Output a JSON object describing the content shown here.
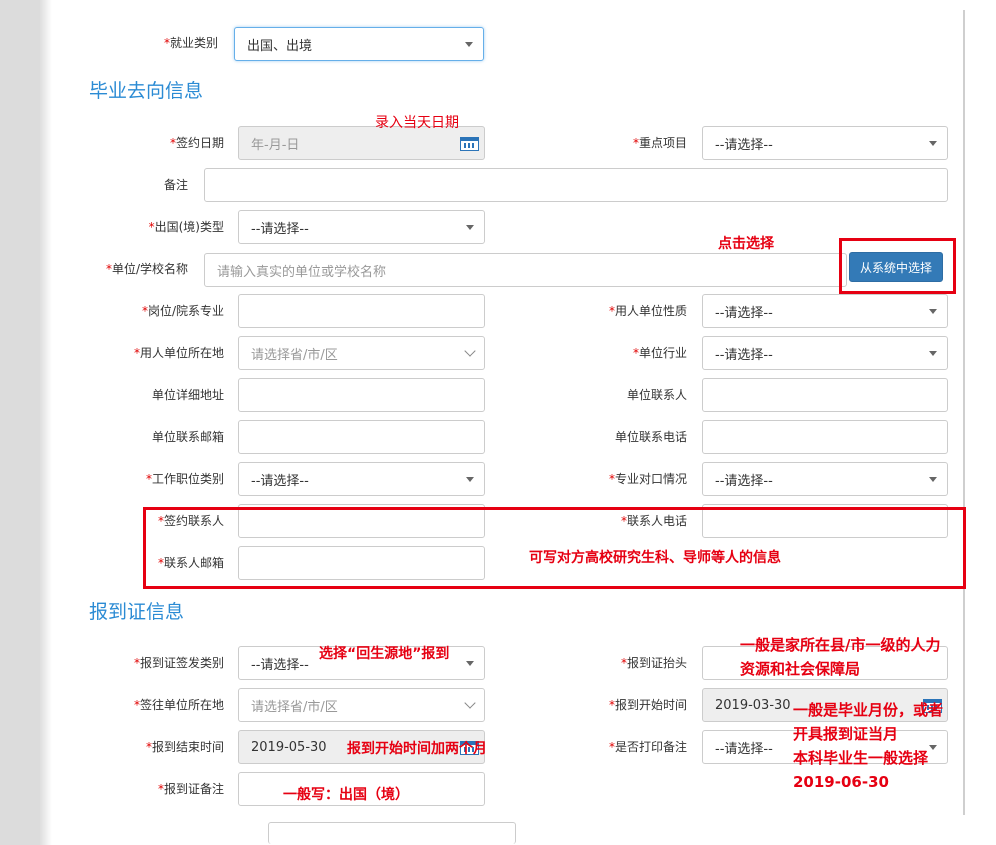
{
  "employment_type": {
    "label": "就业类别",
    "value": "出国、出境"
  },
  "section_destination": "毕业去向信息",
  "sign_date": {
    "label": "签约日期",
    "placeholder": "年-月-日"
  },
  "key_project": {
    "label": "重点项目",
    "value": "--请选择--"
  },
  "remark": {
    "label": "备注",
    "value": ""
  },
  "abroad_type": {
    "label": "出国(境)类型",
    "value": "--请选择--"
  },
  "org_name": {
    "label": "单位/学校名称",
    "placeholder": "请输入真实的单位或学校名称"
  },
  "select_from_system_button": "从系统中选择",
  "position_major": {
    "label": "岗位/院系专业",
    "value": ""
  },
  "employer_nature": {
    "label": "用人单位性质",
    "value": "--请选择--"
  },
  "employer_location": {
    "label": "用人单位所在地",
    "placeholder": "请选择省/市/区"
  },
  "industry": {
    "label": "单位行业",
    "value": "--请选择--"
  },
  "org_address": {
    "label": "单位详细地址",
    "value": ""
  },
  "org_contact": {
    "label": "单位联系人",
    "value": ""
  },
  "org_email": {
    "label": "单位联系邮箱",
    "value": ""
  },
  "org_phone": {
    "label": "单位联系电话",
    "value": ""
  },
  "job_category": {
    "label": "工作职位类别",
    "value": "--请选择--"
  },
  "major_match": {
    "label": "专业对口情况",
    "value": "--请选择--"
  },
  "sign_contact": {
    "label": "签约联系人",
    "value": ""
  },
  "contact_phone": {
    "label": "联系人电话",
    "value": ""
  },
  "contact_email": {
    "label": "联系人邮箱",
    "value": ""
  },
  "section_report": "报到证信息",
  "report_issue_type": {
    "label": "报到证签发类别",
    "value": "--请选择--"
  },
  "report_header": {
    "label": "报到证抬头",
    "value": ""
  },
  "destination_location": {
    "label": "签往单位所在地",
    "placeholder": "请选择省/市/区"
  },
  "report_start": {
    "label": "报到开始时间",
    "value": "2019-03-30"
  },
  "report_end": {
    "label": "报到结束时间",
    "value": "2019-05-30"
  },
  "print_remark": {
    "label": "是否打印备注",
    "value": "--请选择--"
  },
  "report_remark": {
    "label": "报到证备注",
    "value": ""
  },
  "annotations": {
    "today_date": "录入当天日期",
    "click_select": "点击选择",
    "contact_info": "可写对方高校研究生科、导师等人的信息",
    "choose_origin": "选择“回生源地”报到",
    "header_line1": "一般是家所在县/市一级的人力",
    "header_line2": "资源和社会保障局",
    "add_two_months": "报到开始时间加两个月",
    "start_line1": "一般是毕业月份，或者",
    "start_line2": "开具报到证当月",
    "start_line3": "本科毕业生一般选择",
    "start_line4": "2019-06-30",
    "remark_hint": "一般写：出国（境）"
  },
  "colors": {
    "accent": "#2b8bd4",
    "annotation_red": "#e60012",
    "button_blue": "#337ab7",
    "required_red": "#e00000"
  }
}
